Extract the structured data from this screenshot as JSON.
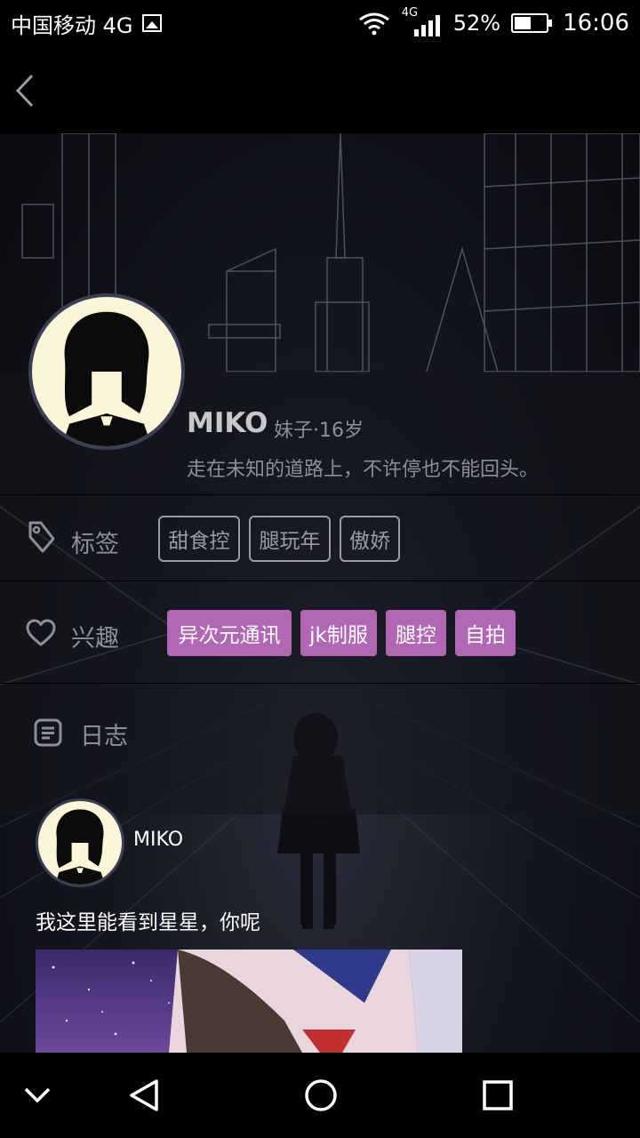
{
  "status_bar": {
    "carrier": "中国移动 4G",
    "network_small": "4G",
    "battery": "52%",
    "battery_level": 0.52,
    "time": "16:06"
  },
  "profile": {
    "name": "MIKO",
    "meta": "妹子·16岁",
    "bio": "走在未知的道路上，不许停也不能回头。"
  },
  "tags": {
    "label": "标签",
    "items": [
      "甜食控",
      "腿玩年",
      "傲娇"
    ]
  },
  "interests": {
    "label": "兴趣",
    "items": [
      "异次元通讯",
      "jk制服",
      "腿控",
      "自拍"
    ],
    "color": "#b267b4"
  },
  "journal": {
    "label": "日志",
    "post": {
      "author": "MIKO",
      "text": "我这里能看到星星，你呢"
    }
  },
  "icons": [
    "back-icon",
    "tag-icon",
    "heart-icon",
    "journal-icon",
    "collapse-icon",
    "back-triangle-icon",
    "home-circle-icon",
    "recents-square-icon"
  ]
}
